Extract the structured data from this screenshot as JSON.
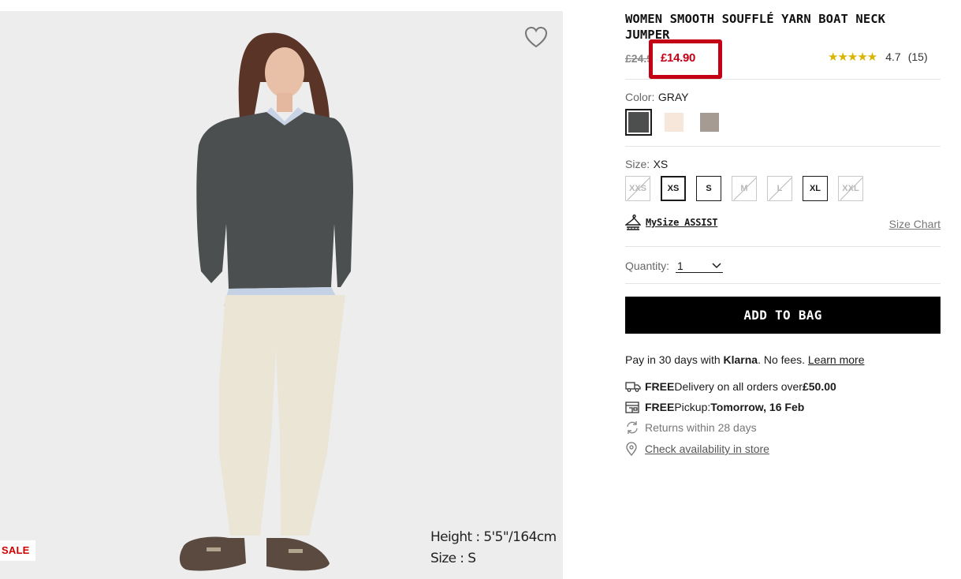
{
  "product": {
    "title": "WOMEN SMOOTH SOUFFLÉ YARN BOAT NECK JUMPER",
    "original_price": "£24.90",
    "sale_price": "£14.90",
    "rating_stars": "★★★★★",
    "rating_value": "4.7",
    "review_count": "(15)"
  },
  "image": {
    "sale_badge": "SALE",
    "model_height": "Height : 5'5\"/164cm",
    "model_size": "Size : S",
    "favorite_icon": "heart-outline-icon"
  },
  "color": {
    "label": "Color:",
    "selected": "GRAY",
    "swatches": [
      {
        "name": "GRAY",
        "hex": "#4c4f4e"
      },
      {
        "name": "OFF WHITE",
        "hex": "#f6e7da"
      },
      {
        "name": "BROWN",
        "hex": "#a69b93"
      }
    ]
  },
  "size": {
    "label": "Size:",
    "selected": "XS",
    "options": [
      {
        "label": "XXS",
        "available": false
      },
      {
        "label": "XS",
        "available": true
      },
      {
        "label": "S",
        "available": true
      },
      {
        "label": "M",
        "available": false
      },
      {
        "label": "L",
        "available": false
      },
      {
        "label": "XL",
        "available": true
      },
      {
        "label": "XXL",
        "available": false
      }
    ],
    "mysize_label": "MySize ASSIST",
    "size_chart_label": "Size Chart"
  },
  "quantity": {
    "label": "Quantity:",
    "value": "1"
  },
  "cta": {
    "add_to_bag": "ADD TO BAG"
  },
  "klarna": {
    "prefix": "Pay in 30 days with ",
    "brand": "Klarna",
    "suffix": ". No fees. ",
    "link": "Learn more"
  },
  "delivery": {
    "free_label": "FREE",
    "delivery_text": " Delivery on all orders over ",
    "threshold": "£50.00",
    "pickup_text": " Pickup: ",
    "pickup_date": "Tomorrow, 16 Feb",
    "returns": "Returns within 28 days",
    "store_link": "Check availability in store"
  },
  "colors": {
    "accent_red": "#c40015",
    "star_gold": "#d9b400",
    "image_bg": "#ededed"
  }
}
